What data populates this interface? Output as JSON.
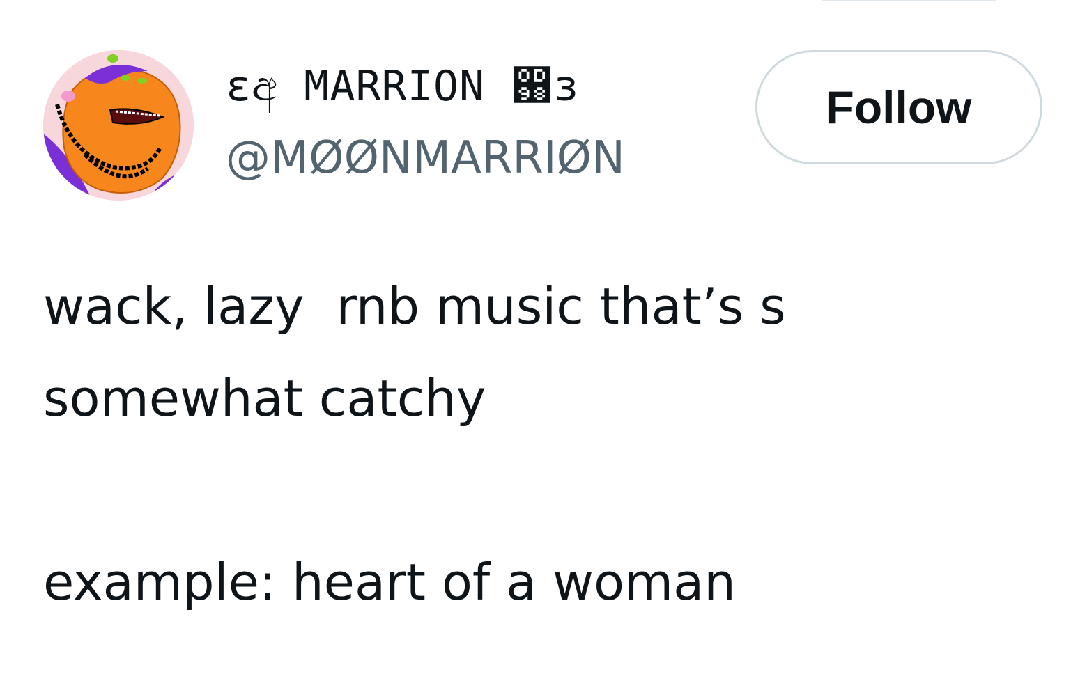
{
  "tweet": {
    "author": {
      "display_name": "εඅ MARRION ඘з",
      "handle": "@MØØNMARRIØN",
      "avatar_icon": "cartoon-avatar"
    },
    "follow_label": "Follow",
    "text_lines": [
      "wack, lazy  rnb music that’s s",
      "somewhat catchy",
      "",
      "example: heart of a woman"
    ]
  },
  "colors": {
    "text": "#0f1419",
    "secondary_text": "#536471",
    "button_border": "#cfd9de",
    "background": "#ffffff",
    "avatar_bg": "#f7d6dc",
    "avatar_skin": "#f7861c",
    "avatar_hat": "#7b2fd6",
    "avatar_accent": "#7ed321"
  }
}
